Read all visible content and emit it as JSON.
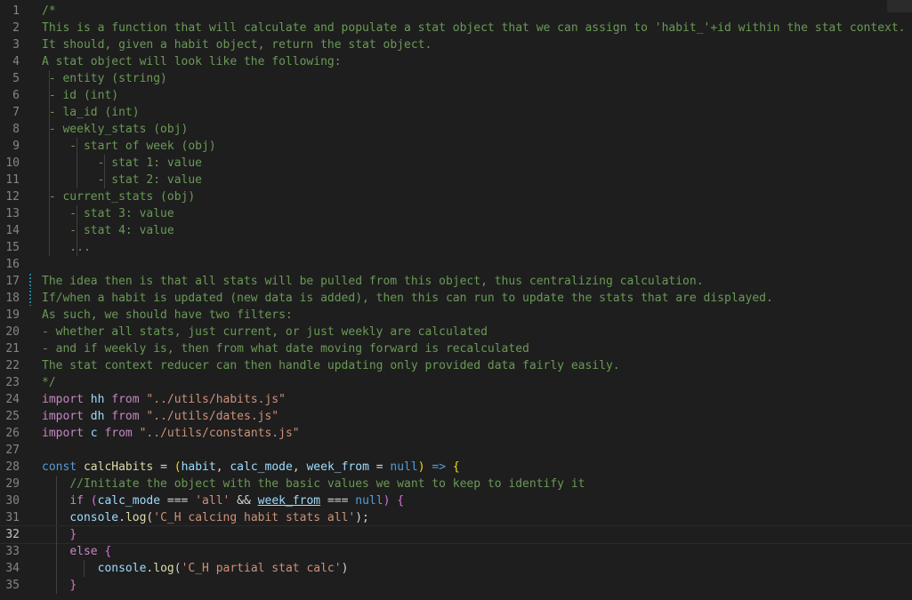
{
  "editor": {
    "current_line": 32,
    "lines": [
      {
        "n": 1,
        "tokens": [
          [
            "comment",
            "/*"
          ]
        ]
      },
      {
        "n": 2,
        "tokens": [
          [
            "comment",
            "This is a function that will calculate and populate a stat object that we can assign to 'habit_'+id within the stat context."
          ]
        ]
      },
      {
        "n": 3,
        "tokens": [
          [
            "comment",
            "It should, given a habit object, return the stat object."
          ]
        ]
      },
      {
        "n": 4,
        "tokens": [
          [
            "comment",
            "A stat object will look like the following:"
          ]
        ]
      },
      {
        "n": 5,
        "tokens": [
          [
            "comment",
            " - entity (string)"
          ]
        ]
      },
      {
        "n": 6,
        "tokens": [
          [
            "comment",
            " - id (int)"
          ]
        ]
      },
      {
        "n": 7,
        "tokens": [
          [
            "comment",
            " - la_id (int)"
          ]
        ]
      },
      {
        "n": 8,
        "tokens": [
          [
            "comment",
            " - weekly_stats (obj)"
          ]
        ]
      },
      {
        "n": 9,
        "tokens": [
          [
            "comment",
            "    - start of week (obj)"
          ]
        ]
      },
      {
        "n": 10,
        "tokens": [
          [
            "comment",
            "        - stat 1: value"
          ]
        ]
      },
      {
        "n": 11,
        "tokens": [
          [
            "comment",
            "        - stat 2: value"
          ]
        ]
      },
      {
        "n": 12,
        "tokens": [
          [
            "comment",
            " - current_stats (obj)"
          ]
        ]
      },
      {
        "n": 13,
        "tokens": [
          [
            "comment",
            "    - stat 3: value"
          ]
        ]
      },
      {
        "n": 14,
        "tokens": [
          [
            "comment",
            "    - stat 4: value"
          ]
        ]
      },
      {
        "n": 15,
        "tokens": [
          [
            "comment",
            "    ..."
          ]
        ]
      },
      {
        "n": 16,
        "tokens": []
      },
      {
        "n": 17,
        "tokens": [
          [
            "comment",
            "The idea then is that all stats will be pulled from this object, thus centralizing calculation."
          ]
        ]
      },
      {
        "n": 18,
        "tokens": [
          [
            "comment",
            "If/when a habit is updated (new data is added), then this can run to update the stats that are displayed."
          ]
        ]
      },
      {
        "n": 19,
        "tokens": [
          [
            "comment",
            "As such, we should have two filters:"
          ]
        ]
      },
      {
        "n": 20,
        "tokens": [
          [
            "comment",
            "- whether all stats, just current, or just weekly are calculated"
          ]
        ]
      },
      {
        "n": 21,
        "tokens": [
          [
            "comment",
            "- and if weekly is, then from what date moving forward is recalculated"
          ]
        ]
      },
      {
        "n": 22,
        "tokens": [
          [
            "comment",
            "The stat context reducer can then handle updating only provided data fairly easily."
          ]
        ]
      },
      {
        "n": 23,
        "tokens": [
          [
            "comment",
            "*/"
          ]
        ]
      },
      {
        "n": 24,
        "tokens": [
          [
            "control",
            "import"
          ],
          [
            "punct",
            " "
          ],
          [
            "var",
            "hh"
          ],
          [
            "punct",
            " "
          ],
          [
            "control",
            "from"
          ],
          [
            "punct",
            " "
          ],
          [
            "string",
            "\"../utils/habits.js\""
          ]
        ]
      },
      {
        "n": 25,
        "tokens": [
          [
            "control",
            "import"
          ],
          [
            "punct",
            " "
          ],
          [
            "var",
            "dh"
          ],
          [
            "punct",
            " "
          ],
          [
            "control",
            "from"
          ],
          [
            "punct",
            " "
          ],
          [
            "string",
            "\"../utils/dates.js\""
          ]
        ]
      },
      {
        "n": 26,
        "tokens": [
          [
            "control",
            "import"
          ],
          [
            "punct",
            " "
          ],
          [
            "var",
            "c"
          ],
          [
            "punct",
            " "
          ],
          [
            "control",
            "from"
          ],
          [
            "punct",
            " "
          ],
          [
            "string",
            "\"../utils/constants.js\""
          ]
        ]
      },
      {
        "n": 27,
        "tokens": []
      },
      {
        "n": 28,
        "tokens": [
          [
            "keyword",
            "const"
          ],
          [
            "punct",
            " "
          ],
          [
            "func",
            "calcHabits"
          ],
          [
            "op",
            " = "
          ],
          [
            "bracket1",
            "("
          ],
          [
            "var",
            "habit"
          ],
          [
            "punct",
            ", "
          ],
          [
            "var",
            "calc_mode"
          ],
          [
            "punct",
            ", "
          ],
          [
            "var",
            "week_from"
          ],
          [
            "op",
            " = "
          ],
          [
            "keyword",
            "null"
          ],
          [
            "bracket1",
            ")"
          ],
          [
            "op",
            " "
          ],
          [
            "keyword",
            "=>"
          ],
          [
            "punct",
            " "
          ],
          [
            "bracket1",
            "{"
          ]
        ]
      },
      {
        "n": 29,
        "tokens": [
          [
            "punct",
            "    "
          ],
          [
            "comment",
            "//Initiate the object with the basic values we want to keep to identify it"
          ]
        ]
      },
      {
        "n": 30,
        "tokens": [
          [
            "punct",
            "    "
          ],
          [
            "control",
            "if"
          ],
          [
            "punct",
            " "
          ],
          [
            "bracket2",
            "("
          ],
          [
            "var",
            "calc_mode"
          ],
          [
            "op",
            " === "
          ],
          [
            "string",
            "'all'"
          ],
          [
            "op",
            " && "
          ],
          [
            "var",
            "week_from"
          ],
          [
            "op",
            " === "
          ],
          [
            "keyword",
            "null"
          ],
          [
            "bracket2",
            ")"
          ],
          [
            "punct",
            " "
          ],
          [
            "bracket2",
            "{"
          ]
        ]
      },
      {
        "n": 31,
        "tokens": [
          [
            "punct",
            "    "
          ],
          [
            "var",
            "console"
          ],
          [
            "punct",
            "."
          ],
          [
            "func",
            "log"
          ],
          [
            "punct",
            "("
          ],
          [
            "string",
            "'C_H calcing habit stats all'"
          ],
          [
            "punct",
            ");"
          ]
        ]
      },
      {
        "n": 32,
        "tokens": [
          [
            "punct",
            "    "
          ],
          [
            "bracket2",
            "}"
          ]
        ]
      },
      {
        "n": 33,
        "tokens": [
          [
            "punct",
            "    "
          ],
          [
            "control",
            "else"
          ],
          [
            "punct",
            " "
          ],
          [
            "bracket2",
            "{"
          ]
        ]
      },
      {
        "n": 34,
        "tokens": [
          [
            "punct",
            "        "
          ],
          [
            "var",
            "console"
          ],
          [
            "punct",
            "."
          ],
          [
            "func",
            "log"
          ],
          [
            "punct",
            "("
          ],
          [
            "string",
            "'C_H partial stat calc'"
          ],
          [
            "punct",
            ")"
          ]
        ]
      },
      {
        "n": 35,
        "tokens": [
          [
            "punct",
            "    "
          ],
          [
            "bracket2",
            "}"
          ]
        ]
      }
    ]
  }
}
